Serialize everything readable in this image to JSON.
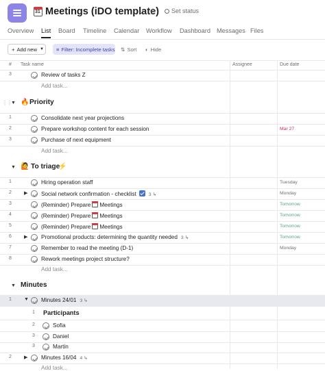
{
  "header": {
    "title": "Meetings (iDO template)",
    "calendar_badge": "31",
    "set_status": "Set status"
  },
  "tabs": [
    "Overview",
    "List",
    "Board",
    "Timeline",
    "Calendar",
    "Workflow",
    "Dashboard",
    "Messages",
    "Files"
  ],
  "active_tab": "List",
  "toolbar": {
    "add_new": "Add new",
    "filter": "Filter: Incomplete tasks",
    "sort": "Sort",
    "hide": "Hide"
  },
  "columns": {
    "num": "#",
    "task": "Task name",
    "assignee": "Assignee",
    "due": "Due date"
  },
  "groups": {
    "top": {
      "rows": [
        {
          "num": "3",
          "name": "Review of tasks Z",
          "due": ""
        }
      ],
      "add_task": "Add task..."
    },
    "priority": {
      "title": "Priority",
      "rows": [
        {
          "num": "1",
          "name": "Consolidate next year projections",
          "due": ""
        },
        {
          "num": "2",
          "name": "Prepare workshop content for each session",
          "due": "Mar 27"
        },
        {
          "num": "3",
          "name": "Purchase of next equipment",
          "due": ""
        }
      ],
      "add_task": "Add task..."
    },
    "triage": {
      "title": "To triage",
      "rows": [
        {
          "num": "1",
          "name": "Hiring operation staff",
          "due": "Tuesday"
        },
        {
          "num": "2",
          "name": "Social network confirmation - checklist",
          "subcount": "3",
          "due": "Monday"
        },
        {
          "num": "3",
          "name_a": "(Reminder) Prepare",
          "name_b": "Meetings",
          "due": "Tomorrow"
        },
        {
          "num": "4",
          "name_a": "(Reminder) Prepare",
          "name_b": "Meetings",
          "due": "Tomorrow"
        },
        {
          "num": "5",
          "name_a": "(Reminder) Prepare",
          "name_b": "Meetings",
          "due": "Tomorrow"
        },
        {
          "num": "6",
          "name": "Promotional products: determining the quantity needed",
          "subcount": "3",
          "due": "Tomorrow"
        },
        {
          "num": "7",
          "name": "Remember to read the meeting (D-1)",
          "due": "Monday"
        },
        {
          "num": "8",
          "name": "Rework meetings project structure?",
          "due": ""
        }
      ],
      "add_task": "Add task..."
    },
    "minutes": {
      "title": "Minutes",
      "rows": [
        {
          "num": "1",
          "name": "Minutes 24/01",
          "subcount": "3"
        },
        {
          "num": "1",
          "name": "Participants"
        },
        {
          "num": "2",
          "name": "Sofia"
        },
        {
          "num": "3",
          "name": "Daniel"
        },
        {
          "num": "3",
          "name": "Martin"
        },
        {
          "num": "2",
          "name": "Minutes 16/04",
          "subcount": "4"
        }
      ],
      "add_task": "Add task..."
    }
  },
  "colors": {
    "accent": "#8d84e8",
    "filter_bg": "#e3e4f8",
    "filter_text": "#3f3fc4",
    "overdue": "#c92f54",
    "soon": "#58a182"
  }
}
